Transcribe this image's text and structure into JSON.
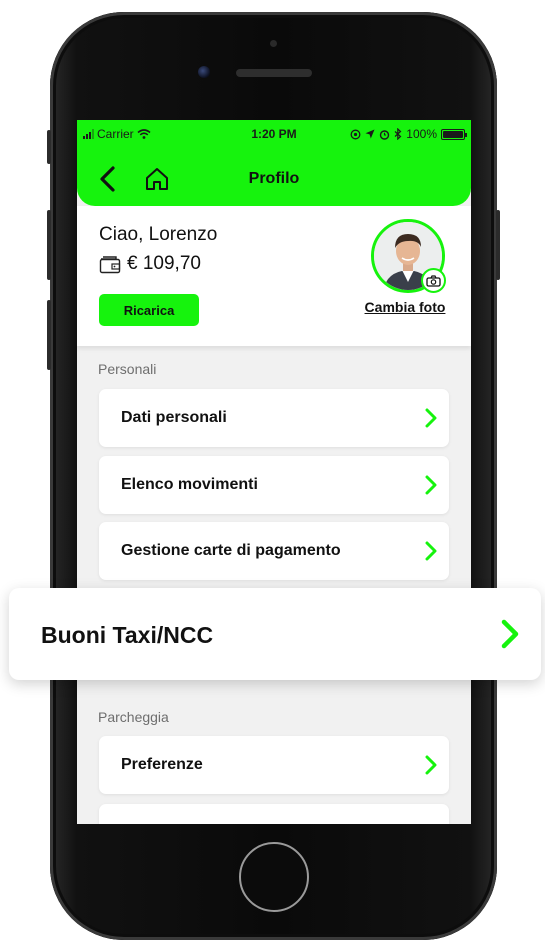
{
  "status_bar": {
    "carrier": "Carrier",
    "time": "1:20 PM",
    "battery": "100%"
  },
  "header": {
    "title": "Profilo"
  },
  "profile": {
    "greeting": "Ciao, Lorenzo",
    "balance": "€ 109,70",
    "recharge_label": "Ricarica",
    "change_photo_label": "Cambia foto"
  },
  "sections": {
    "personal_label": "Personali",
    "parking_label": "Parcheggia"
  },
  "personal_items": [
    {
      "label": "Dati personali"
    },
    {
      "label": "Elenco movimenti"
    },
    {
      "label": "Gestione carte di pagamento"
    }
  ],
  "highlight_item": {
    "label": "Buoni Taxi/NCC"
  },
  "parking_items": [
    {
      "label": "Preferenze"
    }
  ],
  "colors": {
    "accent": "#16f30d",
    "background": "#f1f1f1",
    "card": "#ffffff",
    "text": "#111111"
  }
}
